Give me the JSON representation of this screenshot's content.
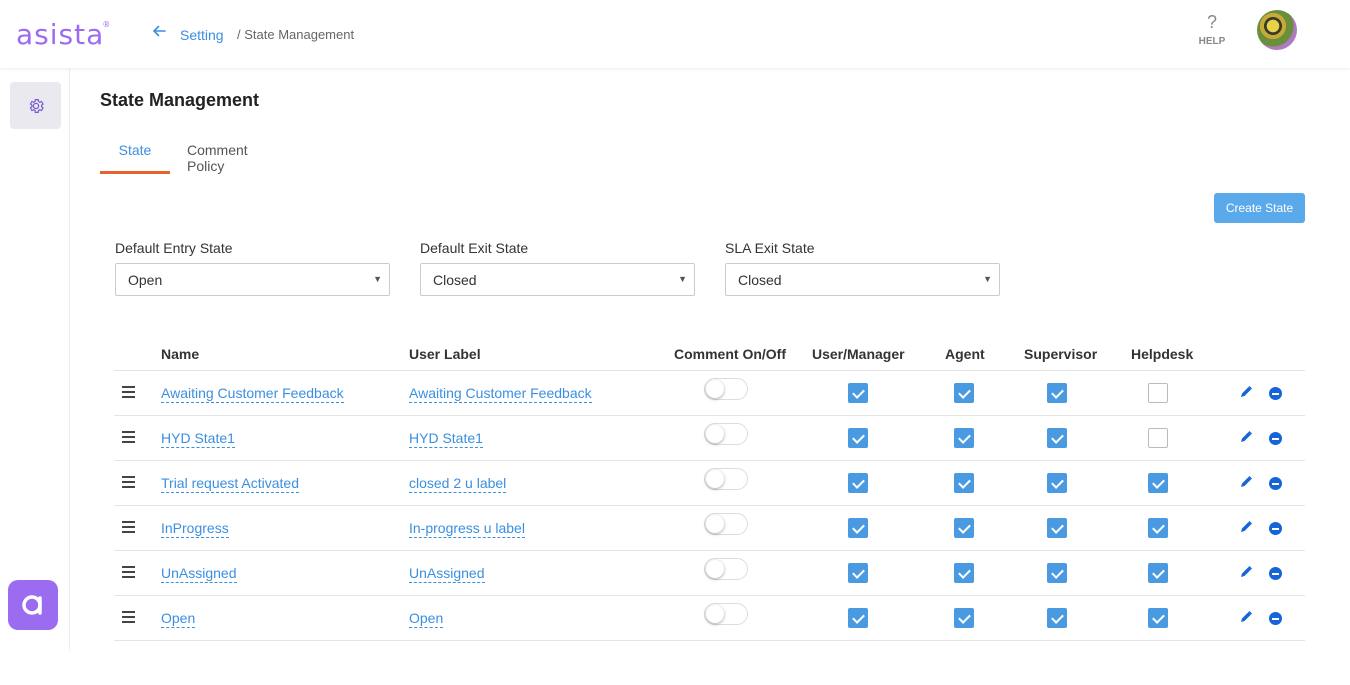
{
  "header": {
    "logo": "asista",
    "logo_mark": "®",
    "back_icon": "arrow-left-icon",
    "breadcrumb_setting": "Setting",
    "breadcrumb_current": "/ State Management",
    "help_symbol": "?",
    "help_label": "HELP"
  },
  "sidebar": {
    "settings_icon": "gear-icon",
    "brand_icon": "asista-a-icon"
  },
  "page": {
    "title": "State Management",
    "tabs": [
      {
        "label": "State",
        "active": true
      },
      {
        "label": "Comment Policy",
        "active": false
      }
    ],
    "create_button": "Create State"
  },
  "defaults": {
    "entry": {
      "label": "Default Entry State",
      "value": "Open"
    },
    "exit": {
      "label": "Default Exit State",
      "value": "Closed"
    },
    "sla": {
      "label": "SLA Exit State",
      "value": "Closed"
    }
  },
  "table": {
    "headers": {
      "name": "Name",
      "user_label": "User Label",
      "comment": "Comment On/Off",
      "user_manager": "User/Manager",
      "agent": "Agent",
      "supervisor": "Supervisor",
      "helpdesk": "Helpdesk"
    },
    "rows": [
      {
        "name": "Awaiting Customer Feedback",
        "user_label": "Awaiting Customer Feedback",
        "comment": false,
        "user_manager": true,
        "agent": true,
        "supervisor": true,
        "helpdesk": false
      },
      {
        "name": "HYD State1",
        "user_label": "HYD State1",
        "comment": false,
        "user_manager": true,
        "agent": true,
        "supervisor": true,
        "helpdesk": false
      },
      {
        "name": "Trial request Activated",
        "user_label": "closed 2 u label",
        "comment": false,
        "user_manager": true,
        "agent": true,
        "supervisor": true,
        "helpdesk": true
      },
      {
        "name": "InProgress",
        "user_label": "In-progress u label",
        "comment": false,
        "user_manager": true,
        "agent": true,
        "supervisor": true,
        "helpdesk": true
      },
      {
        "name": "UnAssigned",
        "user_label": "UnAssigned",
        "comment": false,
        "user_manager": true,
        "agent": true,
        "supervisor": true,
        "helpdesk": true
      },
      {
        "name": "Open",
        "user_label": "Open",
        "comment": false,
        "user_manager": true,
        "agent": true,
        "supervisor": true,
        "helpdesk": true
      }
    ]
  },
  "colors": {
    "brand": "#9b6cf0",
    "link": "#3b8fe0",
    "tab_underline": "#e8632b",
    "checkbox": "#4a9ae2",
    "button": "#5aa9ea",
    "remove": "#1565d8"
  }
}
